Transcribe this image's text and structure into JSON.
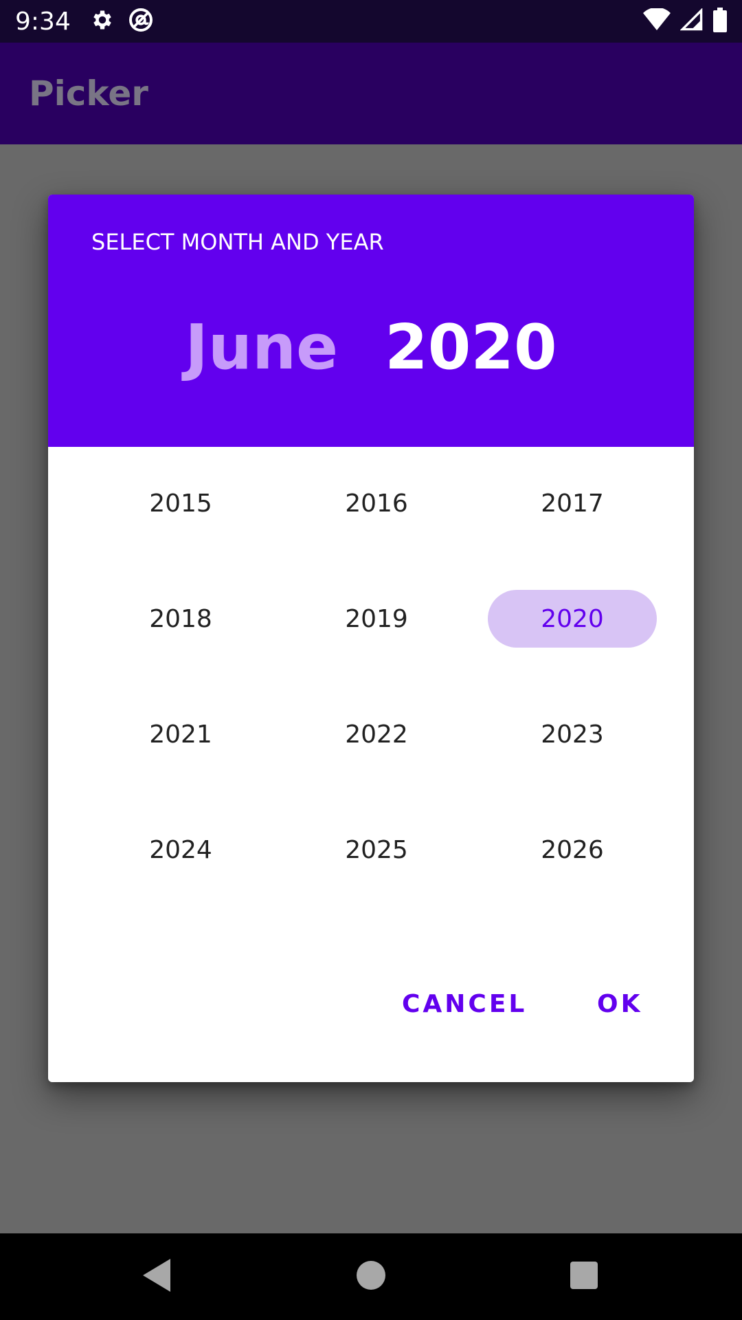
{
  "status_bar": {
    "time": "9:34",
    "icons": [
      "settings-icon",
      "at-sign-icon",
      "wifi-icon",
      "signal-icon",
      "battery-icon"
    ]
  },
  "app_bar": {
    "title": "Picker"
  },
  "dialog": {
    "caption": "SELECT MONTH AND YEAR",
    "selected_month": "June",
    "selected_year": "2020",
    "years": [
      "2015",
      "2016",
      "2017",
      "2018",
      "2019",
      "2020",
      "2021",
      "2022",
      "2023",
      "2024",
      "2025",
      "2026"
    ],
    "selected_index": 5,
    "cancel_label": "CANCEL",
    "ok_label": "OK"
  },
  "nav_bar": {
    "icons": [
      "back-icon",
      "home-icon",
      "recents-icon"
    ]
  },
  "colors": {
    "accent": "#6200ee",
    "month_text": "#c79bfa",
    "selected_year_bg": "#d8c4f5",
    "app_bar": "#290060",
    "status_bar": "#14072e",
    "scrim_bg": "#696969"
  }
}
